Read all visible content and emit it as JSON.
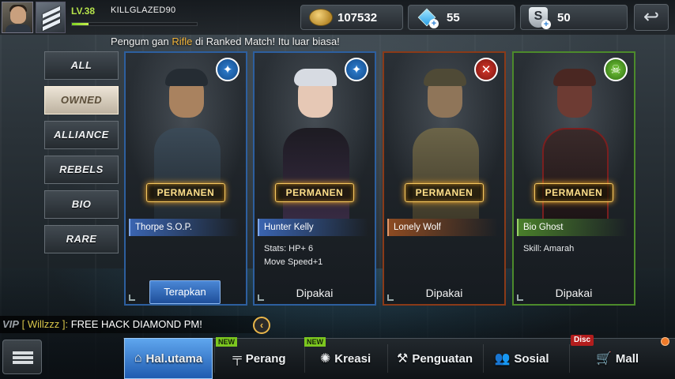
{
  "player": {
    "level": "LV.38",
    "name": "KILLGLAZED90",
    "xp_fraction": 0.13
  },
  "currency": {
    "gold": "107532",
    "diamond": "55",
    "sp": "50"
  },
  "news": {
    "pre": "Pengum gan ",
    "highlight": "Rifle",
    "post": " di Ranked Match! Itu luar biasa!"
  },
  "filters": [
    "ALL",
    "OWNED",
    "ALLIANCE",
    "REBELS",
    "BIO",
    "RARE"
  ],
  "active_filter": "OWNED",
  "cards": [
    {
      "name": "Thorpe S.O.P.",
      "badge": "PERMANEN",
      "stat1": "",
      "stat2": "",
      "status": "",
      "action": "Terapkan",
      "faction": "blue",
      "emblem": "✦"
    },
    {
      "name": "Hunter Kelly",
      "badge": "PERMANEN",
      "stat1": "Stats: HP+ 6",
      "stat2": "Move Speed+1",
      "status": "Dipakai",
      "action": "",
      "faction": "blue",
      "emblem": "✦"
    },
    {
      "name": "Lonely Wolf",
      "badge": "PERMANEN",
      "stat1": "",
      "stat2": "",
      "status": "Dipakai",
      "action": "",
      "faction": "red",
      "emblem": "✕"
    },
    {
      "name": "Bio Ghost",
      "badge": "PERMANEN",
      "stat1": "Skill: Amarah",
      "stat2": "",
      "status": "Dipakai",
      "action": "",
      "faction": "green",
      "emblem": "☠"
    }
  ],
  "chat": {
    "vip": "VIP",
    "user": "[ Willzzz ]:",
    "message": "FREE HACK DIAMOND PM!"
  },
  "nav": {
    "home": "Hal.utama",
    "war": "Perang",
    "create": "Kreasi",
    "upgrade": "Penguatan",
    "social": "Sosial",
    "mall": "Mall",
    "new_badge": "NEW",
    "disc_badge": "Disc"
  },
  "colors": {
    "accent_blue": "#2d5f9f",
    "gold": "#f0b33a",
    "new_green": "#7cc71f",
    "disc_red": "#b21d1d"
  }
}
